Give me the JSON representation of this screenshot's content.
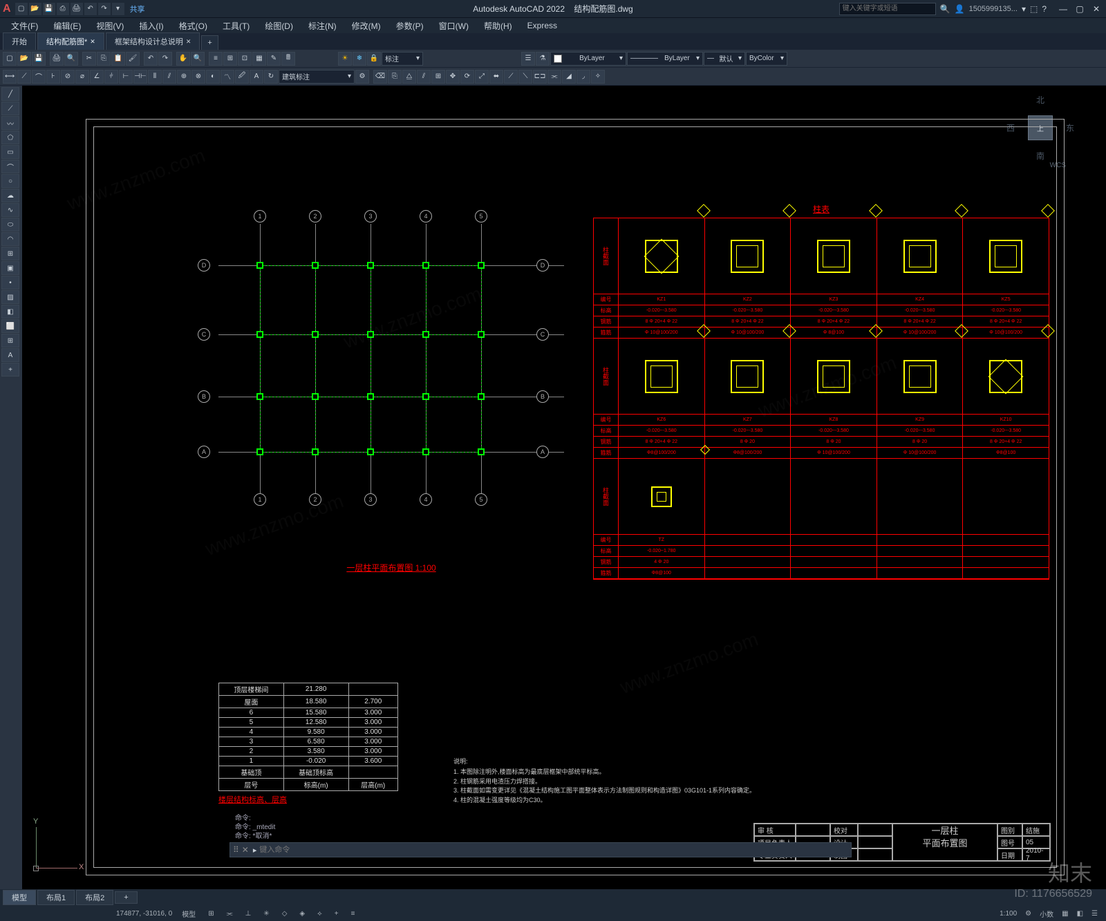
{
  "titlebar": {
    "app_title": "Autodesk AutoCAD 2022",
    "doc_title": "结构配筋图.dwg",
    "share": "共享",
    "search_placeholder": "键入关键字或短语",
    "user": "1505999135...",
    "qat_icons": [
      "new",
      "open",
      "save",
      "saveas",
      "print",
      "undo",
      "redo",
      "plot",
      "cloud",
      "help"
    ]
  },
  "menu": {
    "items": [
      "文件(F)",
      "编辑(E)",
      "视图(V)",
      "插入(I)",
      "格式(O)",
      "工具(T)",
      "绘图(D)",
      "标注(N)",
      "修改(M)",
      "参数(P)",
      "窗口(W)",
      "帮助(H)",
      "Express"
    ]
  },
  "doc_tabs": {
    "items": [
      {
        "label": "开始",
        "active": false,
        "closable": false
      },
      {
        "label": "结构配筋图*",
        "active": true,
        "closable": true
      },
      {
        "label": "框架结构设计总说明",
        "active": false,
        "closable": true
      }
    ],
    "plus": "+"
  },
  "toolbar1": {
    "annot_label": "标注",
    "layer_label": "ByLayer",
    "lt_label": "ByLayer",
    "lw_label": "默认",
    "color_label": "ByColor",
    "dimstyle": "建筑标注"
  },
  "viewcube": {
    "top": "上",
    "n": "北",
    "s": "南",
    "e": "东",
    "w": "西",
    "wcs": "WCS"
  },
  "ucs": {
    "x": "X",
    "y": "Y"
  },
  "drawing": {
    "plan_title": "一层柱平面布置图 1:100",
    "grid_letters": [
      "A",
      "B",
      "C",
      "D"
    ],
    "grid_numbers": [
      "1",
      "2",
      "3",
      "4",
      "5"
    ],
    "column_table": {
      "title": "柱表",
      "side_label": "柱截面",
      "row_headers": [
        "编号",
        "标高",
        "钢筋",
        "箍筋"
      ],
      "cols1": [
        "KZ1",
        "KZ2",
        "KZ3",
        "KZ4",
        "KZ5"
      ],
      "row1_data": {
        "标高": [
          "-0.020~-3.580",
          "-0.020~-3.580",
          "-0.020~-3.580",
          "-0.020~-3.580",
          "-0.020~-3.580"
        ],
        "钢筋": [
          "8 Φ 20+4 Φ 22",
          "8 Φ 20+4 Φ 22",
          "8 Φ 20+4 Φ 22",
          "8 Φ 20+4 Φ 22",
          "8 Φ 20+4 Φ 22"
        ],
        "箍筋": [
          "Φ 10@100/200",
          "Φ 10@100/200",
          "Φ 8@100",
          "Φ 10@100/200",
          "Φ 10@100/200"
        ]
      },
      "cols2": [
        "KZ6",
        "KZ7",
        "KZ8",
        "KZ9",
        "KZ10"
      ],
      "row2_data": {
        "标高": [
          "-0.020~-3.580",
          "-0.020~-3.580",
          "-0.020~-3.580",
          "-0.020~-3.580",
          "-0.020~-3.580"
        ],
        "钢筋": [
          "8 Φ 20+4 Φ 22",
          "8 Φ 20",
          "8 Φ 20",
          "8 Φ 20",
          "8 Φ 20+4 Φ 22"
        ],
        "箍筋": [
          "Φ8@100/200",
          "Φ8@100/200",
          "Φ 10@100/200",
          "Φ 10@100/200",
          "Φ8@100"
        ]
      },
      "cols3": [
        "TZ"
      ],
      "row3_data": {
        "标高": [
          "-0.020~1.780"
        ],
        "钢筋": [
          "4 Φ 20"
        ],
        "箍筋": [
          "Φ8@100"
        ]
      }
    }
  },
  "floor_table": {
    "title": "楼层结构标高、层高",
    "header": [
      "层号",
      "标高(m)",
      "层高(m)"
    ],
    "base_row": [
      "基础顶",
      "基础顶标高",
      ""
    ],
    "rows": [
      [
        "顶层楼梯间",
        "21.280",
        ""
      ],
      [
        "屋面",
        "18.580",
        "2.700"
      ],
      [
        "6",
        "15.580",
        "3.000"
      ],
      [
        "5",
        "12.580",
        "3.000"
      ],
      [
        "4",
        "9.580",
        "3.000"
      ],
      [
        "3",
        "6.580",
        "3.000"
      ],
      [
        "2",
        "3.580",
        "3.000"
      ],
      [
        "1",
        "-0.020",
        "3.600"
      ]
    ]
  },
  "notes": {
    "header": "说明:",
    "items": [
      "1. 本图除注明外,楼面标高为最底层框架中部统平标高。",
      "2. 柱钢筋采用电渣压力焊搭接。",
      "3. 柱截面如需变更详见《混凝土结构施工图平面整体表示方法制图规则和构造详图》03G101-1系列内容确定。",
      "4. 柱的混凝土强度等级均为C30。"
    ]
  },
  "titleblock": {
    "rows": [
      [
        "审  核",
        "",
        "校对",
        "",
        "一层柱",
        "图别",
        "结施"
      ],
      [
        "项目负责人",
        "",
        "设计",
        "",
        "平面布置图",
        "图号",
        "05"
      ],
      [
        "专业负责人",
        "",
        "制图",
        "",
        "",
        "日期",
        "2010-7"
      ]
    ],
    "main_title_l1": "一层柱",
    "main_title_l2": "平面布置图"
  },
  "cmdline": {
    "history": [
      "命令:",
      "命令: _mtedit",
      "命令: *取消*"
    ],
    "prompt": "▸",
    "placeholder": "键入命令"
  },
  "layout_tabs": {
    "items": [
      "模型",
      "布局1",
      "布局2"
    ],
    "plus": "+"
  },
  "statusbar": {
    "coords": "174877, -31016, 0",
    "mode": "模型",
    "scale": "1:100",
    "decimal": "小数",
    "items": [
      "栅格",
      "捕捉",
      "正交",
      "极轴",
      "对象捕捉",
      "动态"
    ]
  },
  "watermark": {
    "brand": "知末",
    "id": "ID: 1176656529",
    "bg": "www.znzmo.com"
  }
}
